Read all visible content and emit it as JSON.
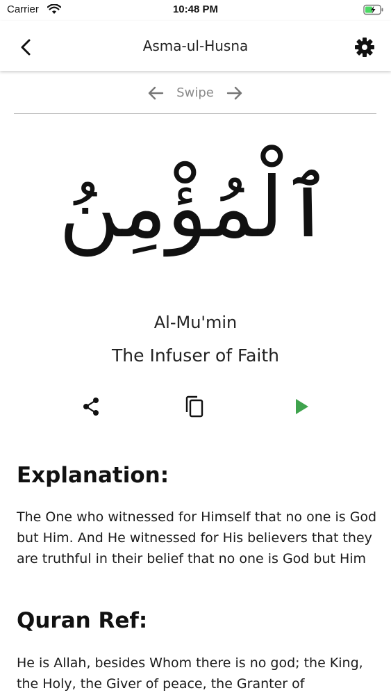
{
  "status_bar": {
    "carrier": "Carrier",
    "time": "10:48 PM",
    "wifi_icon": "wifi-icon",
    "battery_icon": "battery-charging-icon",
    "battery_color": "#4cd964"
  },
  "nav": {
    "title": "Asma-ul-Husna",
    "back_icon": "chevron-left-icon",
    "settings_icon": "gear-icon"
  },
  "swipe": {
    "label": "Swipe",
    "prev_icon": "arrow-left-icon",
    "next_icon": "arrow-right-icon"
  },
  "name": {
    "arabic": "ٱلْمُؤْمِنُ",
    "transliteration": "Al-Mu'min",
    "meaning": "The Infuser of Faith"
  },
  "actions": {
    "share_icon": "share-icon",
    "copy_icon": "copy-icon",
    "play_icon": "play-icon",
    "play_color": "#3fa34d"
  },
  "explanation": {
    "heading": "Explanation:",
    "text": "The One who witnessed for Himself that no one is God but Him. And He witnessed for His believers that they are truthful in their belief that no one is God but Him"
  },
  "quran_ref": {
    "heading": "Quran Ref:",
    "text": "He is Allah, besides Whom there is no god; the King, the Holy, the Giver of peace, the Granter of"
  }
}
